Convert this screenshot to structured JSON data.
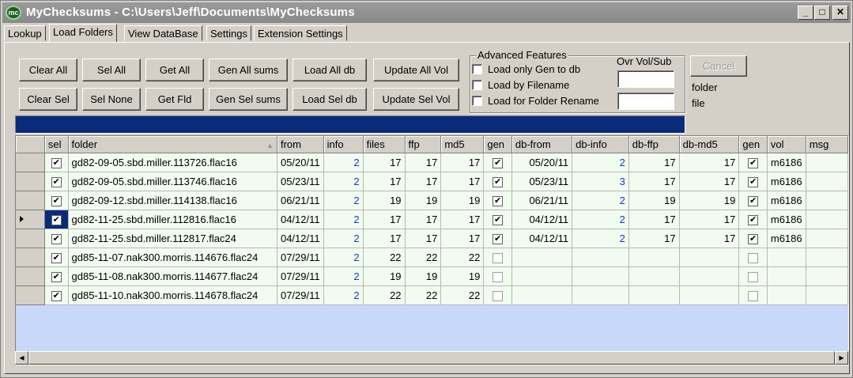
{
  "window": {
    "title": "MyChecksums  -  C:\\Users\\Jeff\\Documents\\MyChecksums",
    "icon_text": "mc"
  },
  "title_buttons": {
    "minimize": "_",
    "maximize": "□",
    "close": "✕"
  },
  "tabs": [
    {
      "label": "Lookup",
      "active": false
    },
    {
      "label": "Load Folders",
      "active": true
    },
    {
      "label": "View DataBase",
      "active": false
    },
    {
      "label": "Settings",
      "active": false
    },
    {
      "label": "Extension Settings",
      "active": false
    }
  ],
  "buttons": {
    "clear_all": "Clear All",
    "sel_all": "Sel All",
    "get_all": "Get All",
    "gen_all_sums": "Gen All sums",
    "load_all_db": "Load All db",
    "update_all_vol": "Update All Vol",
    "clear_sel": "Clear Sel",
    "sel_none": "Sel None",
    "get_fld": "Get Fld",
    "gen_sel_sums": "Gen Sel sums",
    "load_sel_db": "Load Sel db",
    "update_sel_vol": "Update Sel Vol",
    "cancel": "Cancel"
  },
  "advanced": {
    "legend": "Advanced Features",
    "options": [
      {
        "label": "Load only Gen to db",
        "checked": false
      },
      {
        "label": "Load by Filename",
        "checked": false
      },
      {
        "label": "Load for Folder Rename",
        "checked": false
      }
    ],
    "ovr_label": "Ovr Vol/Sub",
    "ovr_value_1": "",
    "ovr_value_2": ""
  },
  "status": {
    "folder_label": "folder",
    "file_label": "file"
  },
  "grid": {
    "columns": [
      "sel",
      "folder",
      "from",
      "info",
      "files",
      "ffp",
      "md5",
      "gen",
      "db-from",
      "db-info",
      "db-ffp",
      "db-md5",
      "gen",
      "vol",
      "msg"
    ],
    "sort_indicator": "▲",
    "selected_row_index": 3,
    "rows": [
      {
        "sel": true,
        "folder": "gd82-09-05.sbd.miller.113726.flac16",
        "from": "05/20/11",
        "info": "2",
        "files": "17",
        "ffp": "17",
        "md5": "17",
        "gen": true,
        "db_from": "05/20/11",
        "db_info": "2",
        "db_ffp": "17",
        "db_md5": "17",
        "gen2": true,
        "vol": "m6186",
        "msg": ""
      },
      {
        "sel": true,
        "folder": "gd82-09-05.sbd.miller.113746.flac16",
        "from": "05/23/11",
        "info": "2",
        "files": "17",
        "ffp": "17",
        "md5": "17",
        "gen": true,
        "db_from": "05/23/11",
        "db_info": "3",
        "db_ffp": "17",
        "db_md5": "17",
        "gen2": true,
        "vol": "m6186",
        "msg": ""
      },
      {
        "sel": true,
        "folder": "gd82-09-12.sbd.miller.114138.flac16",
        "from": "06/21/11",
        "info": "2",
        "files": "19",
        "ffp": "19",
        "md5": "19",
        "gen": true,
        "db_from": "06/21/11",
        "db_info": "2",
        "db_ffp": "19",
        "db_md5": "19",
        "gen2": true,
        "vol": "m6186",
        "msg": ""
      },
      {
        "sel": true,
        "folder": "gd82-11-25.sbd.miller.112816.flac16",
        "from": "04/12/11",
        "info": "2",
        "files": "17",
        "ffp": "17",
        "md5": "17",
        "gen": true,
        "db_from": "04/12/11",
        "db_info": "2",
        "db_ffp": "17",
        "db_md5": "17",
        "gen2": true,
        "vol": "m6186",
        "msg": ""
      },
      {
        "sel": true,
        "folder": "gd82-11-25.sbd.miller.112817.flac24",
        "from": "04/12/11",
        "info": "2",
        "files": "17",
        "ffp": "17",
        "md5": "17",
        "gen": true,
        "db_from": "04/12/11",
        "db_info": "2",
        "db_ffp": "17",
        "db_md5": "17",
        "gen2": true,
        "vol": "m6186",
        "msg": ""
      },
      {
        "sel": true,
        "folder": "gd85-11-07.nak300.morris.114676.flac24",
        "from": "07/29/11",
        "info": "2",
        "files": "22",
        "ffp": "22",
        "md5": "22",
        "gen": false,
        "db_from": "",
        "db_info": "",
        "db_ffp": "",
        "db_md5": "",
        "gen2": false,
        "vol": "",
        "msg": ""
      },
      {
        "sel": true,
        "folder": "gd85-11-08.nak300.morris.114677.flac24",
        "from": "07/29/11",
        "info": "2",
        "files": "19",
        "ffp": "19",
        "md5": "19",
        "gen": false,
        "db_from": "",
        "db_info": "",
        "db_ffp": "",
        "db_md5": "",
        "gen2": false,
        "vol": "",
        "msg": ""
      },
      {
        "sel": true,
        "folder": "gd85-11-10.nak300.morris.114678.flac24",
        "from": "07/29/11",
        "info": "2",
        "files": "22",
        "ffp": "22",
        "md5": "22",
        "gen": false,
        "db_from": "",
        "db_info": "",
        "db_ffp": "",
        "db_md5": "",
        "gen2": false,
        "vol": "",
        "msg": ""
      }
    ]
  },
  "scrollbar": {
    "left_arrow": "◀",
    "right_arrow": "▶"
  },
  "colors": {
    "progress_bar": "#0a2a7a",
    "link_number": "#1a38c9",
    "grid_background": "#c8d8f8",
    "row_background": "#f2fbf0"
  }
}
